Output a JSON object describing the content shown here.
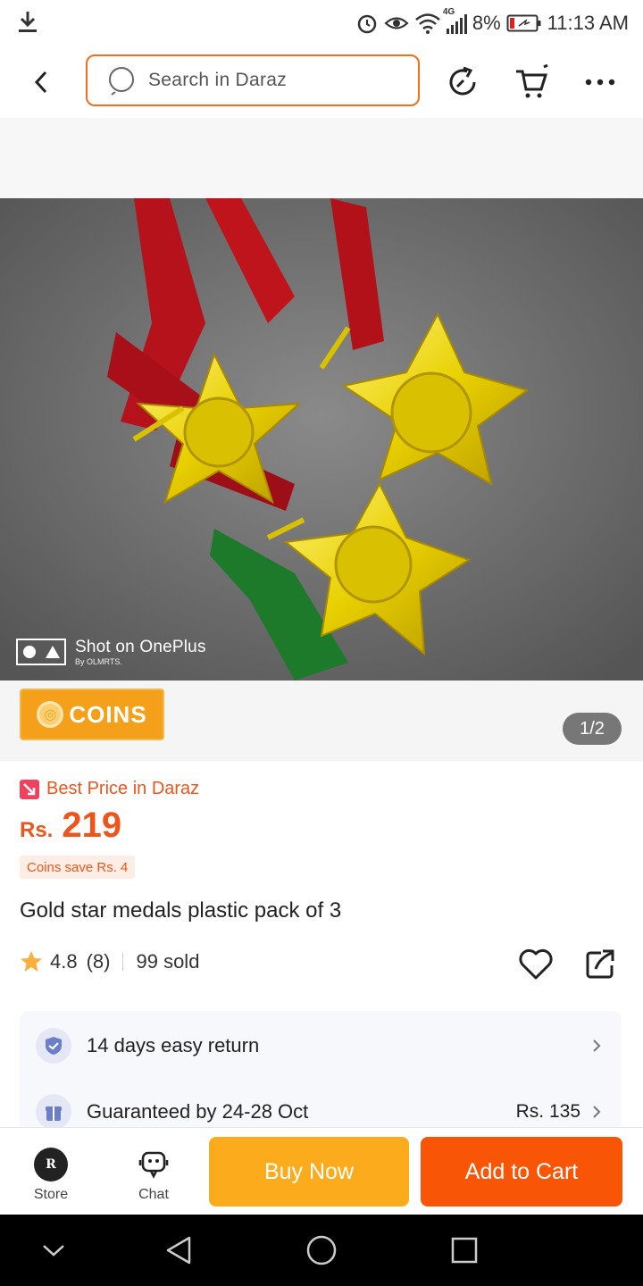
{
  "status_bar": {
    "network": "4G",
    "battery": "8%",
    "time": "11:13 AM"
  },
  "header": {
    "search_placeholder": "Search in Daraz",
    "icons": [
      "back-icon",
      "search-icon",
      "share-icon",
      "cart-icon",
      "more-icon"
    ]
  },
  "product_image": {
    "watermark_line1": "Shot on OnePlus",
    "watermark_line2": "By OLMRTS.",
    "coins_label": "COINS",
    "pager": "1/2"
  },
  "price": {
    "best_price_label": "Best Price in Daraz",
    "currency": "Rs.",
    "amount": "219",
    "coins_save": "Coins save Rs. 4"
  },
  "product": {
    "title": "Gold star medals plastic pack of 3",
    "rating": "4.8",
    "reviews": "(8)",
    "sold": "99 sold"
  },
  "services": [
    {
      "label": "14 days easy return",
      "value": ""
    },
    {
      "label": "Guaranteed by 24-28 Oct",
      "value": "Rs. 135"
    }
  ],
  "bottom_bar": {
    "store_label": "Store",
    "chat_label": "Chat",
    "buy_now": "Buy Now",
    "add_to_cart": "Add to Cart"
  },
  "colors": {
    "accent": "#f85606",
    "price": "#f0541b",
    "buy_now": "#fbab1b",
    "coins": "#f5a01a"
  }
}
